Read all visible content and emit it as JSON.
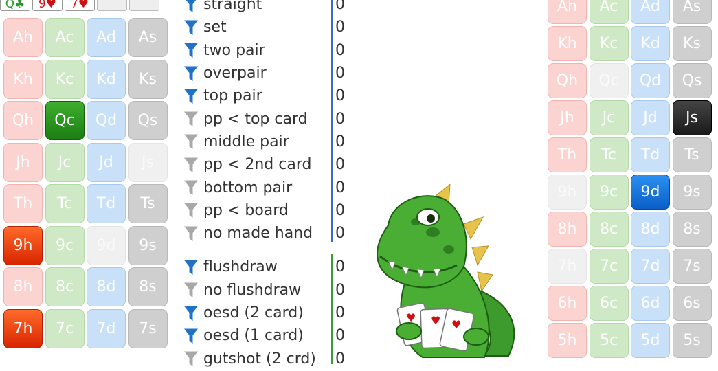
{
  "board": [
    {
      "label": "Q♣",
      "color": "#2a9a2a"
    },
    {
      "label": "9♥",
      "color": "#d01010"
    },
    {
      "label": "7♥",
      "color": "#d01010"
    },
    {
      "label": "",
      "color": "#222"
    },
    {
      "label": "",
      "color": "#222"
    }
  ],
  "left_grid": [
    [
      {
        "label": "Ah",
        "s": "h",
        "st": "n"
      },
      {
        "label": "Ac",
        "s": "c",
        "st": "n"
      },
      {
        "label": "Ad",
        "s": "d",
        "st": "n"
      },
      {
        "label": "As",
        "s": "s",
        "st": "n"
      }
    ],
    [
      {
        "label": "Kh",
        "s": "h",
        "st": "n"
      },
      {
        "label": "Kc",
        "s": "c",
        "st": "n"
      },
      {
        "label": "Kd",
        "s": "d",
        "st": "n"
      },
      {
        "label": "Ks",
        "s": "s",
        "st": "n"
      }
    ],
    [
      {
        "label": "Qh",
        "s": "h",
        "st": "n"
      },
      {
        "label": "Qc",
        "s": "c",
        "st": "sel"
      },
      {
        "label": "Qd",
        "s": "d",
        "st": "n"
      },
      {
        "label": "Qs",
        "s": "s",
        "st": "n"
      }
    ],
    [
      {
        "label": "Jh",
        "s": "h",
        "st": "n"
      },
      {
        "label": "Jc",
        "s": "c",
        "st": "n"
      },
      {
        "label": "Jd",
        "s": "d",
        "st": "n"
      },
      {
        "label": "Js",
        "s": "s",
        "st": "faded"
      }
    ],
    [
      {
        "label": "Th",
        "s": "h",
        "st": "n"
      },
      {
        "label": "Tc",
        "s": "c",
        "st": "n"
      },
      {
        "label": "Td",
        "s": "d",
        "st": "n"
      },
      {
        "label": "Ts",
        "s": "s",
        "st": "n"
      }
    ],
    [
      {
        "label": "9h",
        "s": "h",
        "st": "sel"
      },
      {
        "label": "9c",
        "s": "c",
        "st": "n"
      },
      {
        "label": "9d",
        "s": "d",
        "st": "faded"
      },
      {
        "label": "9s",
        "s": "s",
        "st": "n"
      }
    ],
    [
      {
        "label": "8h",
        "s": "h",
        "st": "n"
      },
      {
        "label": "8c",
        "s": "c",
        "st": "n"
      },
      {
        "label": "8d",
        "s": "d",
        "st": "n"
      },
      {
        "label": "8s",
        "s": "s",
        "st": "n"
      }
    ],
    [
      {
        "label": "7h",
        "s": "h",
        "st": "sel"
      },
      {
        "label": "7c",
        "s": "c",
        "st": "n"
      },
      {
        "label": "7d",
        "s": "d",
        "st": "n"
      },
      {
        "label": "7s",
        "s": "s",
        "st": "n"
      }
    ]
  ],
  "right_grid": [
    [
      {
        "label": "Ah",
        "s": "h",
        "st": "n"
      },
      {
        "label": "Ac",
        "s": "c",
        "st": "n"
      },
      {
        "label": "Ad",
        "s": "d",
        "st": "n"
      },
      {
        "label": "As",
        "s": "s",
        "st": "n"
      }
    ],
    [
      {
        "label": "Kh",
        "s": "h",
        "st": "n"
      },
      {
        "label": "Kc",
        "s": "c",
        "st": "n"
      },
      {
        "label": "Kd",
        "s": "d",
        "st": "n"
      },
      {
        "label": "Ks",
        "s": "s",
        "st": "n"
      }
    ],
    [
      {
        "label": "Qh",
        "s": "h",
        "st": "n"
      },
      {
        "label": "Qc",
        "s": "c",
        "st": "faded"
      },
      {
        "label": "Qd",
        "s": "d",
        "st": "n"
      },
      {
        "label": "Qs",
        "s": "s",
        "st": "n"
      }
    ],
    [
      {
        "label": "Jh",
        "s": "h",
        "st": "n"
      },
      {
        "label": "Jc",
        "s": "c",
        "st": "n"
      },
      {
        "label": "Jd",
        "s": "d",
        "st": "n"
      },
      {
        "label": "Js",
        "s": "s",
        "st": "sel"
      }
    ],
    [
      {
        "label": "Th",
        "s": "h",
        "st": "n"
      },
      {
        "label": "Tc",
        "s": "c",
        "st": "n"
      },
      {
        "label": "Td",
        "s": "d",
        "st": "n"
      },
      {
        "label": "Ts",
        "s": "s",
        "st": "n"
      }
    ],
    [
      {
        "label": "9h",
        "s": "h",
        "st": "faded"
      },
      {
        "label": "9c",
        "s": "c",
        "st": "n"
      },
      {
        "label": "9d",
        "s": "d",
        "st": "sel"
      },
      {
        "label": "9s",
        "s": "s",
        "st": "n"
      }
    ],
    [
      {
        "label": "8h",
        "s": "h",
        "st": "n"
      },
      {
        "label": "8c",
        "s": "c",
        "st": "n"
      },
      {
        "label": "8d",
        "s": "d",
        "st": "n"
      },
      {
        "label": "8s",
        "s": "s",
        "st": "n"
      }
    ],
    [
      {
        "label": "7h",
        "s": "h",
        "st": "faded"
      },
      {
        "label": "7c",
        "s": "c",
        "st": "n"
      },
      {
        "label": "7d",
        "s": "d",
        "st": "n"
      },
      {
        "label": "7s",
        "s": "s",
        "st": "n"
      }
    ],
    [
      {
        "label": "6h",
        "s": "h",
        "st": "n"
      },
      {
        "label": "6c",
        "s": "c",
        "st": "n"
      },
      {
        "label": "6d",
        "s": "d",
        "st": "n"
      },
      {
        "label": "6s",
        "s": "s",
        "st": "n"
      }
    ],
    [
      {
        "label": "5h",
        "s": "h",
        "st": "n"
      },
      {
        "label": "5c",
        "s": "c",
        "st": "n"
      },
      {
        "label": "5d",
        "s": "d",
        "st": "n"
      },
      {
        "label": "5s",
        "s": "s",
        "st": "n"
      }
    ]
  ],
  "filters_made": [
    {
      "label": "straight",
      "count": "0",
      "active": true
    },
    {
      "label": "set",
      "count": "0",
      "active": true
    },
    {
      "label": "two pair",
      "count": "0",
      "active": true
    },
    {
      "label": "overpair",
      "count": "0",
      "active": true
    },
    {
      "label": "top pair",
      "count": "0",
      "active": true
    },
    {
      "label": "pp < top card",
      "count": "0",
      "active": false
    },
    {
      "label": "middle pair",
      "count": "0",
      "active": false
    },
    {
      "label": "pp < 2nd card",
      "count": "0",
      "active": false
    },
    {
      "label": "bottom pair",
      "count": "0",
      "active": false
    },
    {
      "label": "pp < board",
      "count": "0",
      "active": false
    },
    {
      "label": "no made hand",
      "count": "0",
      "active": false
    }
  ],
  "filters_draws": [
    {
      "label": "flushdraw",
      "count": "0",
      "active": true
    },
    {
      "label": "no flushdraw",
      "count": "0",
      "active": false
    },
    {
      "label": "oesd (2 card)",
      "count": "0",
      "active": true
    },
    {
      "label": "oesd (1 card)",
      "count": "0",
      "active": true
    },
    {
      "label": "gutshot (2 crd)",
      "count": "0",
      "active": false
    }
  ],
  "colors": {
    "funnel_active": "#1f72c8",
    "funnel_inactive": "#a8a8a8",
    "divider_made": "#3a6bc8",
    "divider_draws": "#3a9b3a"
  },
  "icons": {
    "filter": "funnel-icon",
    "mascot": "dinosaur-mascot"
  }
}
